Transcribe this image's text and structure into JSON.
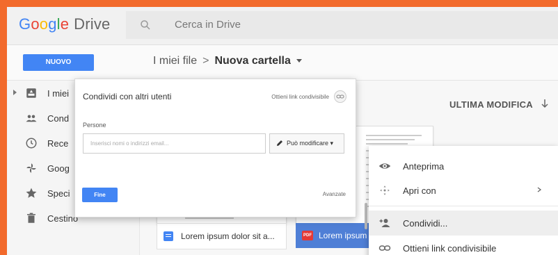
{
  "header": {
    "logo_google": [
      "G",
      "o",
      "o",
      "g",
      "l",
      "e"
    ],
    "logo_drive": "Drive",
    "search_placeholder": "Cerca in Drive"
  },
  "toolbar": {
    "new_button": "NUOVO",
    "breadcrumb_parent": "I miei file",
    "breadcrumb_sep": ">",
    "breadcrumb_current": "Nuova cartella"
  },
  "sidebar": {
    "items": [
      {
        "label": "I miei",
        "icon": "drive-icon"
      },
      {
        "label": "Cond",
        "icon": "people-icon"
      },
      {
        "label": "Rece",
        "icon": "clock-icon"
      },
      {
        "label": "Goog",
        "icon": "photos-icon"
      },
      {
        "label": "Speci",
        "icon": "star-icon"
      },
      {
        "label": "Cestino",
        "icon": "trash-icon"
      }
    ]
  },
  "main": {
    "column_header": "ULTIMA MODIFICA",
    "files": [
      {
        "name": "Lorem ipsum dolor sit a...",
        "type": "doc"
      },
      {
        "name": "Lorem ipsum",
        "type": "pdf",
        "badge": "PDF"
      }
    ]
  },
  "share_dialog": {
    "title": "Condividi con altri utenti",
    "get_link": "Ottieni link condivisibile",
    "people_label": "Persone",
    "input_placeholder": "Inserisci nomi o indirizzi email...",
    "permission": "Può modificare",
    "done_button": "Fine",
    "advanced": "Avanzate"
  },
  "context_menu": {
    "items": [
      {
        "label": "Anteprima",
        "icon": "eye-icon"
      },
      {
        "label": "Apri con",
        "icon": "apps-icon"
      },
      {
        "label": "Condividi...",
        "icon": "add-person-icon"
      },
      {
        "label": "Ottieni link condivisibile",
        "icon": "link-icon"
      }
    ]
  },
  "colors": {
    "accent": "#4285f4",
    "border_frame": "#f26a2c",
    "pdf_red": "#e53935"
  }
}
